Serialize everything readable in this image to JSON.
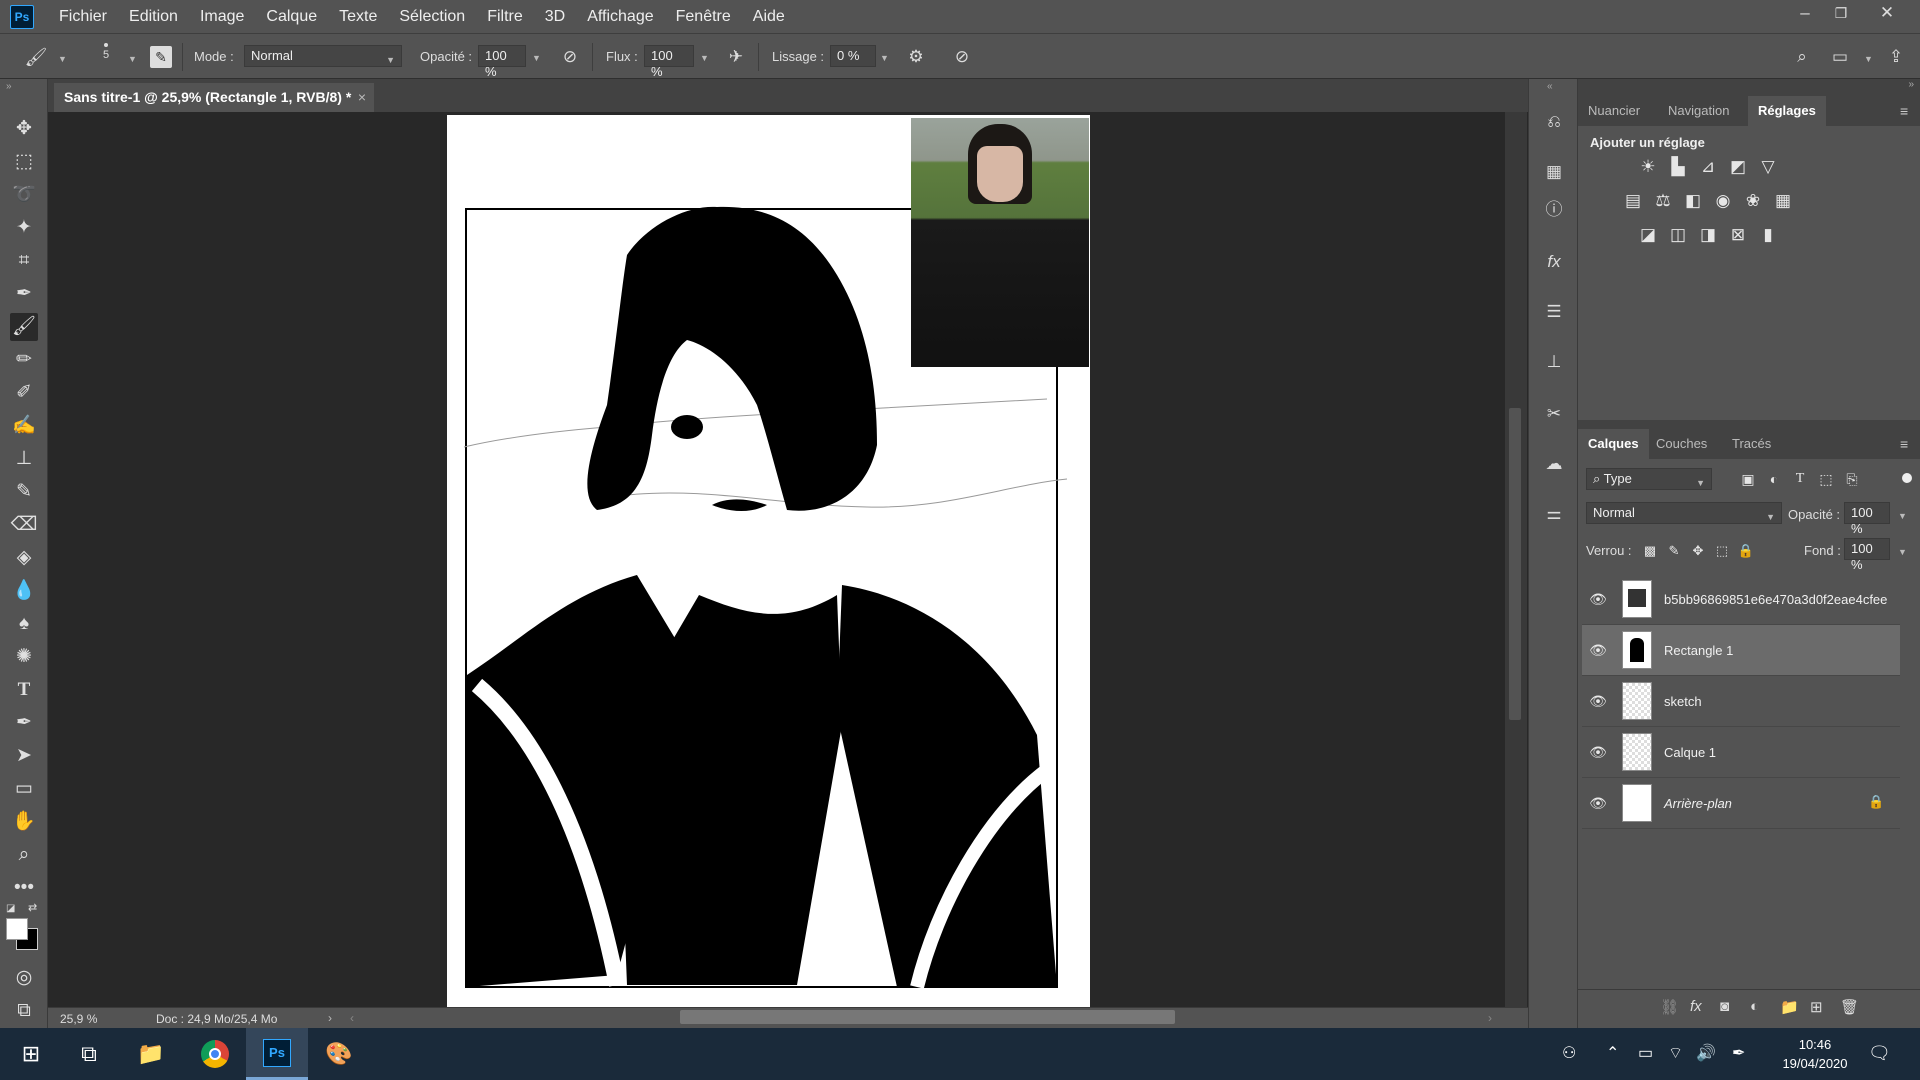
{
  "menubar": {
    "logo": "Ps",
    "items": [
      "Fichier",
      "Edition",
      "Image",
      "Calque",
      "Texte",
      "Sélection",
      "Filtre",
      "3D",
      "Affichage",
      "Fenêtre",
      "Aide"
    ]
  },
  "options": {
    "brush_size": "5",
    "mode_label": "Mode :",
    "mode_value": "Normal",
    "opacity_label": "Opacité :",
    "opacity_value": "100 %",
    "flow_label": "Flux :",
    "flow_value": "100 %",
    "smoothing_label": "Lissage :",
    "smoothing_value": "0 %"
  },
  "document": {
    "tab_title": "Sans titre-1 @ 25,9% (Rectangle 1, RVB/8) *",
    "close": "×"
  },
  "status": {
    "zoom": "25,9 %",
    "doc_size": "Doc : 24,9 Mo/25,4 Mo"
  },
  "adjust_panel": {
    "tabs": [
      "Nuancier",
      "Navigation",
      "Réglages"
    ],
    "active_tab": "Réglages",
    "heading": "Ajouter un réglage"
  },
  "layers_panel": {
    "tabs": [
      "Calques",
      "Couches",
      "Tracés"
    ],
    "active_tab": "Calques",
    "filter_value": "Type",
    "blend_mode": "Normal",
    "opacity_label": "Opacité :",
    "opacity_value": "100 %",
    "lock_label": "Verrou :",
    "fill_label": "Fond :",
    "fill_value": "100 %",
    "layers": [
      {
        "name": "b5bb96869851e6e470a3d0f2eae4cfee",
        "selected": false,
        "thumb": "image"
      },
      {
        "name": "Rectangle 1",
        "selected": true,
        "thumb": "drawing"
      },
      {
        "name": "sketch",
        "selected": false,
        "thumb": "transparent"
      },
      {
        "name": "Calque 1",
        "selected": false,
        "thumb": "transparent"
      },
      {
        "name": "Arrière-plan",
        "selected": false,
        "thumb": "white",
        "locked": true
      }
    ]
  },
  "taskbar": {
    "time": "10:46",
    "date": "19/04/2020"
  },
  "colors": {
    "panel_bg": "#535353",
    "canvas_bg": "#282828",
    "selected_layer": "#6b6b6b",
    "taskbar": "#1a2a3a",
    "ps_blue": "#31a8ff"
  }
}
